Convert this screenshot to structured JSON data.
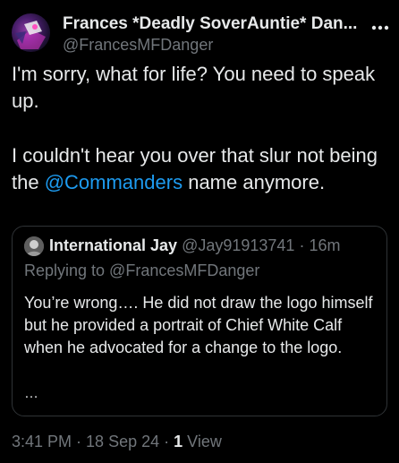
{
  "author": {
    "display_name": "Frances *Deadly SoverAuntie* Dan...",
    "handle": "@FrancesMFDanger",
    "avatar_icon": "profile-avatar"
  },
  "menu": {
    "more_icon": "more-dots-icon"
  },
  "post": {
    "line1": "I'm sorry, what for life? You need to speak up.",
    "line2_before": "I couldn't hear you over that slur not being the ",
    "line2_mention": "@Commanders",
    "line2_after": " name anymore."
  },
  "quote": {
    "name": "International Jay",
    "handle": "@Jay91913741",
    "separator": "·",
    "time": "16m",
    "replying_to": "Replying to @FrancesMFDanger",
    "text": "You’re wrong…. He did not draw the logo himself but he provided a portrait of Chief White Calf when he advocated for a change to the logo.",
    "ellipsis": "…"
  },
  "meta": {
    "time": "3:41 PM",
    "sep1": " · ",
    "date": "18 Sep 24",
    "sep2": " · ",
    "views_count": "1",
    "views_label": " View"
  },
  "colors": {
    "background": "#000000",
    "text": "#e7e9ea",
    "muted": "#71767b",
    "link": "#1d9bf0",
    "border": "#2f3336"
  }
}
